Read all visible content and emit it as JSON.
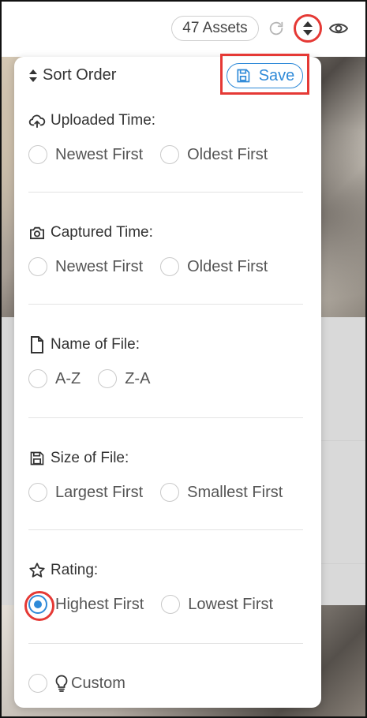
{
  "toolbar": {
    "assets_label": "47 Assets",
    "refresh_icon": "refresh-icon",
    "sort_icon": "sort-icon",
    "view_icon": "eye-icon"
  },
  "panel": {
    "title": "Sort Order",
    "save_label": "Save",
    "sections": [
      {
        "title": "Uploaded Time:",
        "icon": "cloud-upload-icon",
        "options": [
          {
            "label": "Newest First",
            "checked": false
          },
          {
            "label": "Oldest First",
            "checked": false
          }
        ]
      },
      {
        "title": "Captured Time:",
        "icon": "camera-icon",
        "options": [
          {
            "label": "Newest First",
            "checked": false
          },
          {
            "label": "Oldest First",
            "checked": false
          }
        ]
      },
      {
        "title": "Name of File:",
        "icon": "file-icon",
        "options": [
          {
            "label": "A-Z",
            "checked": false
          },
          {
            "label": "Z-A",
            "checked": false
          }
        ]
      },
      {
        "title": "Size of File:",
        "icon": "floppy-icon",
        "options": [
          {
            "label": "Largest First",
            "checked": false
          },
          {
            "label": "Smallest First",
            "checked": false
          }
        ]
      },
      {
        "title": "Rating:",
        "icon": "star-icon",
        "options": [
          {
            "label": "Highest First",
            "checked": true
          },
          {
            "label": "Lowest First",
            "checked": false
          }
        ]
      }
    ],
    "custom": {
      "label": "Custom",
      "icon": "lightbulb-icon",
      "checked": false
    }
  },
  "colors": {
    "accent": "#2f8ad8",
    "highlight": "#e53935"
  }
}
